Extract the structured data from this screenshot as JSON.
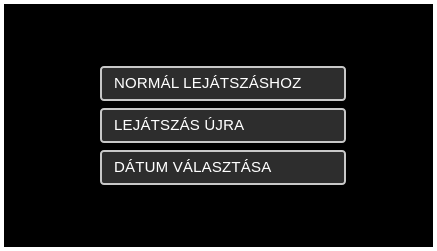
{
  "menu": {
    "items": [
      {
        "label": "NORMÁL LEJÁTSZÁSHOZ"
      },
      {
        "label": "LEJÁTSZÁS ÚJRA"
      },
      {
        "label": "DÁTUM VÁLASZTÁSA"
      }
    ]
  },
  "colors": {
    "screen_background": "#000000",
    "button_background": "#2d2d2d",
    "button_border": "#c8c8c8",
    "text": "#ffffff"
  }
}
